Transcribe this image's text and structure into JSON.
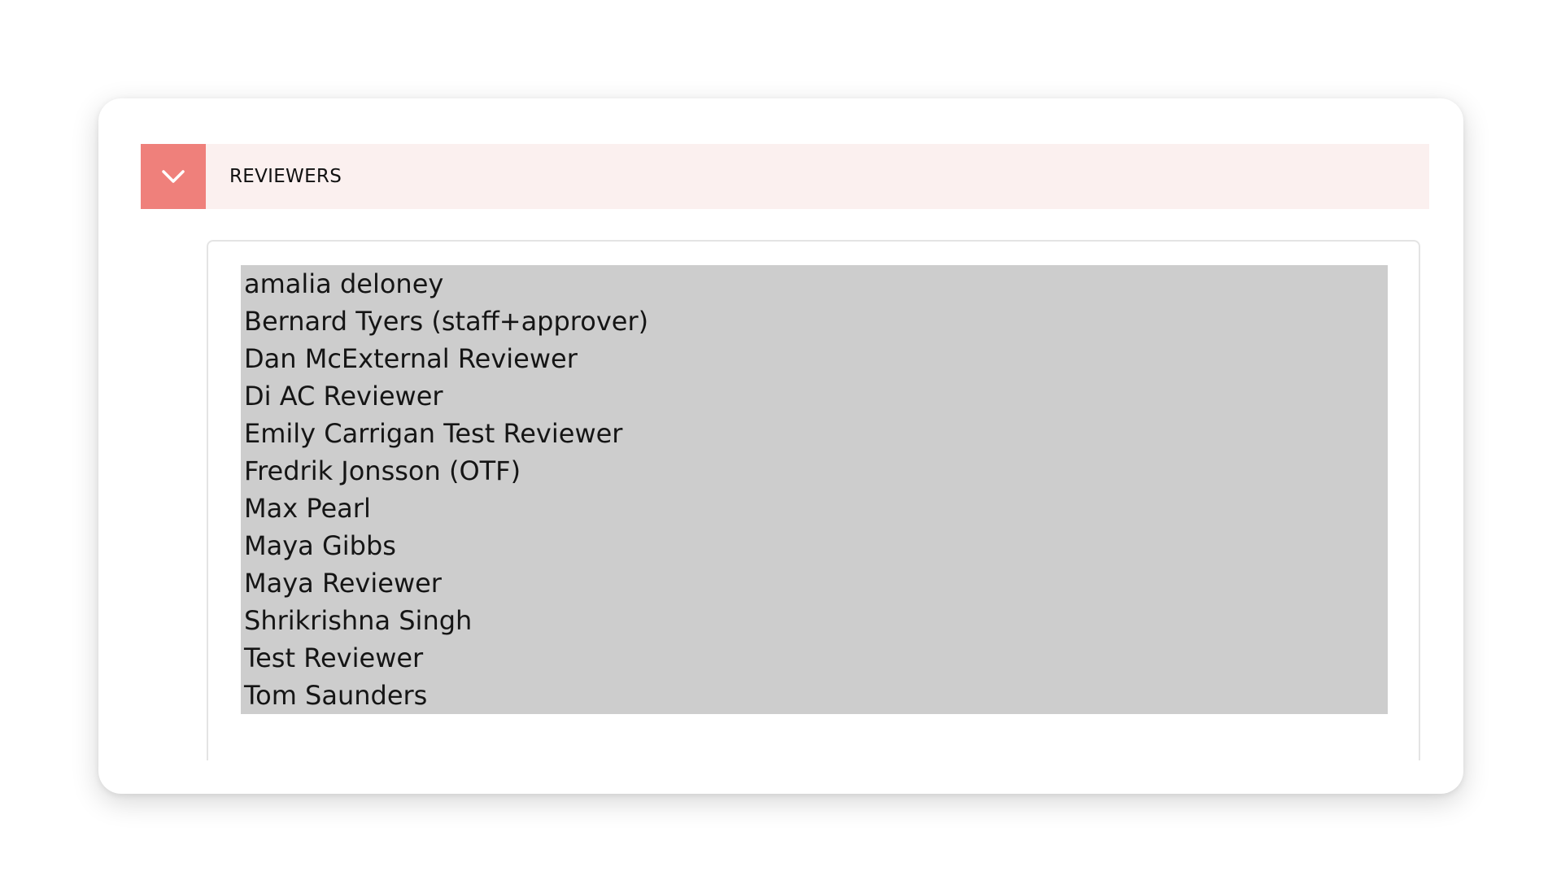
{
  "section": {
    "title": "REVIEWERS",
    "toggle_icon": "chevron-down-icon",
    "accent_color": "#ef807b",
    "header_bg": "#fbf0ef"
  },
  "reviewers": {
    "selection_bg": "#cdcdcd",
    "items": [
      "amalia deloney",
      "Bernard Tyers (staff+approver)",
      "Dan McExternal Reviewer",
      "Di AC Reviewer",
      "Emily Carrigan Test Reviewer",
      "Fredrik Jonsson (OTF)",
      "Max Pearl",
      "Maya Gibbs",
      "Maya Reviewer",
      "Shrikrishna Singh",
      "Test Reviewer",
      "Tom Saunders"
    ]
  }
}
